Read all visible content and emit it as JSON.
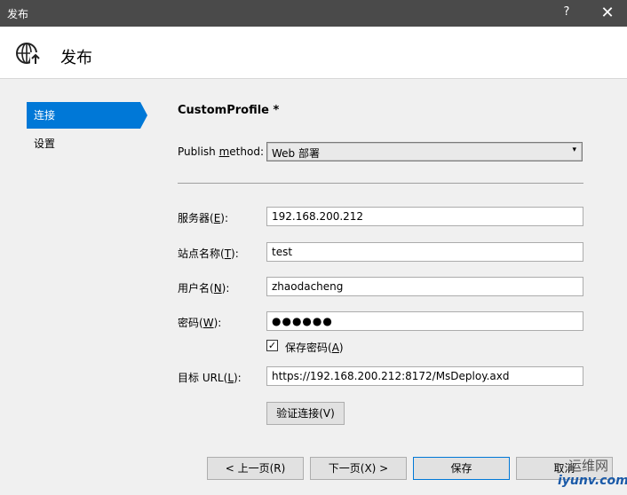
{
  "window": {
    "title": "发布",
    "help": "?",
    "close": "✕"
  },
  "header": {
    "title": "发布"
  },
  "sidebar": {
    "items": [
      {
        "label": "连接"
      },
      {
        "label": "设置"
      }
    ]
  },
  "profile": {
    "name": "CustomProfile *"
  },
  "publish_method": {
    "label_pre": "Publish ",
    "label_key": "m",
    "label_post": "ethod:",
    "value": "Web 部署"
  },
  "fields": {
    "server": {
      "label_pre": "服务器(",
      "key": "E",
      "label_post": "):",
      "value": "192.168.200.212"
    },
    "site": {
      "label_pre": "站点名称(",
      "key": "T",
      "label_post": "):",
      "value": "test"
    },
    "user": {
      "label_pre": "用户名(",
      "key": "N",
      "label_post": "):",
      "value": "zhaodacheng"
    },
    "password": {
      "label_pre": "密码(",
      "key": "W",
      "label_post": "):",
      "value": "●●●●●●"
    },
    "save_password": {
      "label_pre": "保存密码(",
      "key": "A",
      "label_post": ")",
      "checked": "✓"
    },
    "url": {
      "label_pre": "目标 URL(",
      "key": "L",
      "label_post": "):",
      "value": "https://192.168.200.212:8172/MsDeploy.axd"
    }
  },
  "buttons": {
    "validate": "验证连接(V)",
    "prev": "< 上一页(R)",
    "next": "下一页(X) >",
    "save": "保存",
    "cancel": "取消"
  },
  "watermark": {
    "line1": "运维网",
    "line2": "iyunv.com"
  },
  "colors": {
    "accent": "#0078d7",
    "titlebar": "#4a4a4a"
  }
}
